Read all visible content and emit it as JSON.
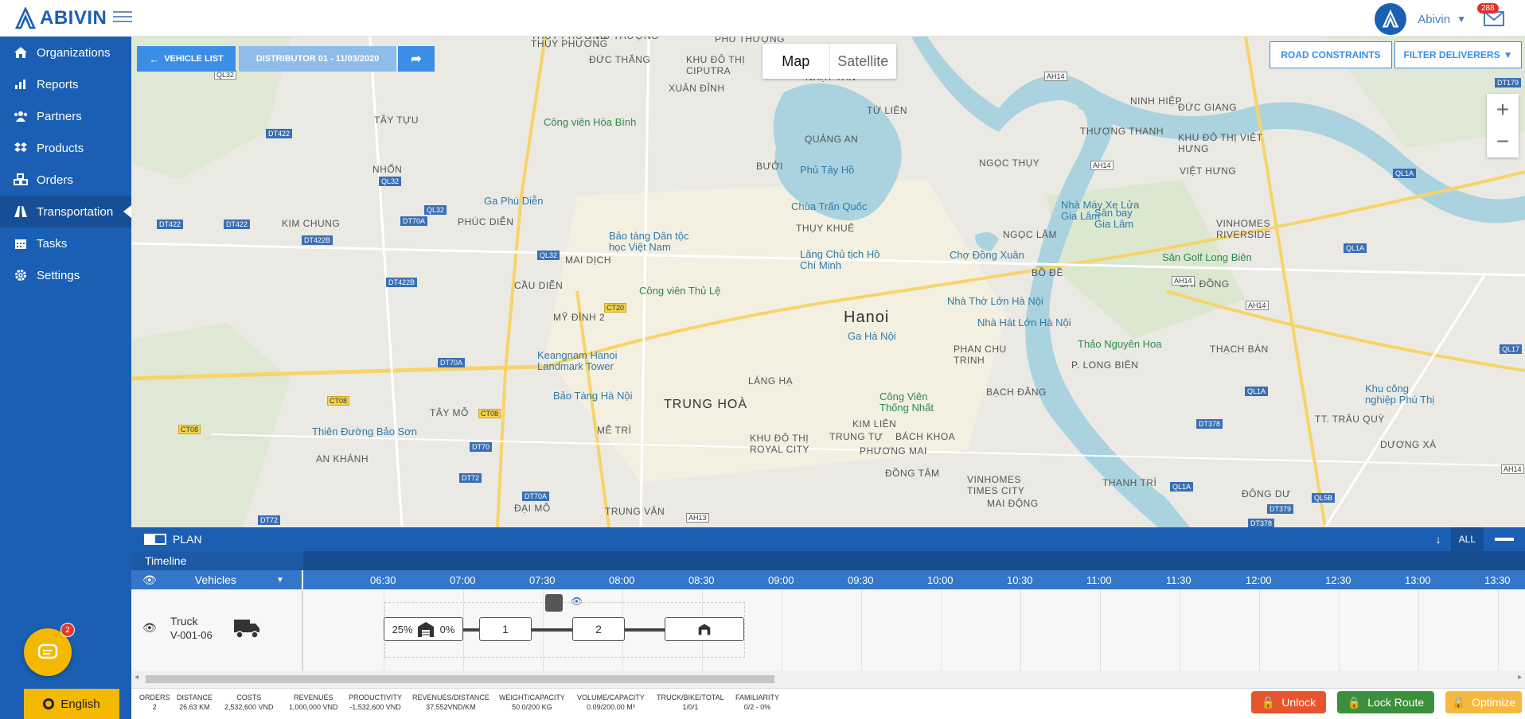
{
  "app": {
    "brand": "ABIVIN"
  },
  "user": {
    "name": "Abivin",
    "mail_count": "288"
  },
  "nav": {
    "items": [
      {
        "label": "Organizations",
        "icon": "home-icon"
      },
      {
        "label": "Reports",
        "icon": "chart-icon"
      },
      {
        "label": "Partners",
        "icon": "users-icon"
      },
      {
        "label": "Products",
        "icon": "dropbox-icon"
      },
      {
        "label": "Orders",
        "icon": "cubes-icon"
      },
      {
        "label": "Transportation",
        "icon": "road-icon",
        "active": true
      },
      {
        "label": "Tasks",
        "icon": "calendar-icon"
      },
      {
        "label": "Settings",
        "icon": "gear-icon"
      }
    ]
  },
  "chat": {
    "badge": "2"
  },
  "language": {
    "label": "English"
  },
  "map": {
    "vehicle_list_btn": "VEHICLE LIST",
    "distributor_btn": "DISTRIBUTOR 01 - 11/03/2020",
    "road_constraints_btn": "ROAD CONSTRAINTS",
    "filter_deliverers_btn": "FILTER DELIVERERS",
    "map_tab": "Map",
    "satellite_tab": "Satellite",
    "zoom_in": "+",
    "zoom_out": "−",
    "labels": {
      "hanoi": "Hanoi",
      "trung_hoa": "TRUNG HOÀ",
      "thuy_phuong": "THỤY PHƯƠNG",
      "duc_thang": "ĐỨC THẮNG",
      "phu_thuong": "PHÚ THƯỢNG",
      "xuan_dinh": "XUÂN ĐỈNH",
      "tay_tuu": "TÂY TỰU",
      "nhon": "NHỔN",
      "kim_chung": "KIM CHUNG",
      "phuc_dien": "PHÚC DIỄN",
      "mai_dich": "MAI DỊCH",
      "cau_dien": "CẦU DIỄN",
      "my_dinh2": "MỸ ĐÌNH 2",
      "tay_mo": "TÂY MỖ",
      "an_khanh": "AN KHÁNH",
      "me_tri": "MỄ TRÌ",
      "dai_mo": "ĐẠI MỖ",
      "trung_van": "TRUNG VĂN",
      "quang_an": "QUẢNG AN",
      "buoi": "BƯỞI",
      "thuy_khue": "THỤY KHUÊ",
      "tu_lien": "TỨ LIÊN",
      "ngoc_thuy": "NGỌC THỤY",
      "ngoc_lam": "NGỌC LÂM",
      "bo_de": "BỒ ĐỀ",
      "sai_dong": "SÀI ĐỒNG",
      "thach_ban": "THẠCH BÀN",
      "p_long_bien": "P. LONG BIÊN",
      "lang_ha": "LÁNG HẠ",
      "kim_lien": "KIM LIÊN",
      "trung_tu": "TRUNG TỰ",
      "bach_khoa": "BÁCH KHOA",
      "phuong_mai": "PHƯƠNG MAI",
      "dong_tam": "ĐỒNG TÂM",
      "mai_dong": "MAI ĐỘNG",
      "thanh_tri": "THANH TRÌ",
      "bach_dang": "BẠCH ĐẰNG",
      "phan_chu_trinh": "PHAN CHU TRINH",
      "thuong_thanh": "THƯỢNG THANH",
      "duc_giang": "ĐỨC GIANG",
      "viet_hung": "VIỆT HƯNG",
      "ninh_hiep": "NINH HIỆP",
      "duong_xa": "DƯƠNG XÁ",
      "tt_trau_quy": "TT. TRÂU QUỲ",
      "dong_du": "ĐÔNG DƯ",
      "cv_hoa_binh": "Công viên Hòa Bình",
      "ga_phu_dien": "Ga Phú Diễn",
      "bao_tang_dan_toc": "Bảo tàng Dân tộc học Việt Nam",
      "cv_thu_le": "Công viên Thủ Lệ",
      "keangnam": "Keangnam Hanoi Landmark Tower",
      "bao_tang_ha_noi": "Bảo Tàng Hà Nội",
      "thien_duong": "Thiên Đường Bảo Sơn",
      "phu_tay_ho": "Phủ Tây Hồ",
      "chua_tran_quoc": "Chùa Trấn Quốc",
      "lang_chu_tich": "Lăng Chủ tịch Hồ Chí Minh",
      "cho_dong_xuan": "Chợ Đồng Xuân",
      "nha_tho": "Nhà Thờ Lớn Hà Nội",
      "nha_hat": "Nhà Hát Lớn Hà Nội",
      "ga_ha_noi": "Ga Hà Nội",
      "cv_thong_nhat": "Công Viên Thống Nhất",
      "thao_nguyen": "Thảo Nguyên Hoa",
      "san_bay": "Sân bay Gia Lâm",
      "nha_may_xe_lua": "Nhà Máy Xe Lửa Gia Lâm",
      "san_golf": "Sân Golf Long Biên",
      "vinhomes_riverside": "VINHOMES RIVERSIDE",
      "vinhomes_times": "VINHOMES TIMES CITY",
      "khu_do_thi_ciputra": "KHU ĐÔ THỊ CIPUTRA",
      "khu_do_thi_royal": "KHU ĐÔ THỊ ROYAL CITY",
      "khu_do_thi_viet_hung": "KHU ĐÔ THỊ VIỆT HƯNG",
      "kcn_phu_thi": "Khu công nghiệp Phú Thị",
      "nhat_tan": "NHẬT TÂN"
    },
    "shields": {
      "ql32a": "QL32",
      "dt422a": "DT422",
      "dt422b": "DT422",
      "dt422c": "DT422",
      "ql32b": "QL32",
      "dt70a": "DT70A",
      "ql32c": "QL32",
      "ql32d": "QL32",
      "dt422b2": "DT422B",
      "dt422b3": "DT422B",
      "ct20": "CT20",
      "dt70a2": "DT70A",
      "ct08a": "CT08",
      "ct08b": "CT08",
      "ct08c": "CT08",
      "dt70": "DT70",
      "dt72a": "DT72",
      "dt70a3": "DT70A",
      "ah13": "AH13",
      "dt72b": "DT72",
      "ah14a": "AH14",
      "ah14b": "AH14",
      "ah14c": "AH14",
      "ah14d": "AH14",
      "ah14e": "AH14",
      "ql1a1": "QL1A",
      "ql1a2": "QL1A",
      "ql1a3": "QL1A",
      "ql1a4": "QL1A",
      "dt179": "DT179",
      "ql17": "QL17",
      "dt378a": "DT378",
      "dt378b": "DT378",
      "dt379": "DT379",
      "ql5b": "QL5B",
      "ah14f": "AH14"
    }
  },
  "plan": {
    "title": "PLAN",
    "all_label": "ALL",
    "timeline_label": "Timeline",
    "vehicles_label": "Vehicles",
    "times": [
      "06:30",
      "07:00",
      "07:30",
      "08:00",
      "08:30",
      "09:00",
      "09:30",
      "10:00",
      "10:30",
      "11:00",
      "11:30",
      "12:00",
      "12:30",
      "13:00",
      "13:30"
    ],
    "vehicle": {
      "type": "Truck",
      "id": "V-001-06"
    },
    "route": {
      "start_pct": "25%",
      "end_pct": "0%",
      "stop1": "1",
      "stop2": "2"
    }
  },
  "stats": [
    {
      "label": "ORDERS",
      "value": "2"
    },
    {
      "label": "DISTANCE",
      "value": "26.63 KM"
    },
    {
      "label": "COSTS",
      "value": "2,532,600 VND"
    },
    {
      "label": "REVENUES",
      "value": "1,000,000 VND"
    },
    {
      "label": "PRODUCTIVITY",
      "value": "-1,532,600 VND"
    },
    {
      "label": "REVENUES/DISTANCE",
      "value": "37,552VND/KM"
    },
    {
      "label": "WEIGHT/CAPACITY",
      "value": "50.0/200 KG"
    },
    {
      "label": "VOLUME/CAPACITY",
      "value": "0.09/200.00 M³"
    },
    {
      "label": "TRUCK/BIKE/TOTAL",
      "value": "1/0/1"
    },
    {
      "label": "FAMILIARITY",
      "value": "0/2 - 0%"
    }
  ],
  "actions": {
    "unlock": "Unlock",
    "lock_route": "Lock Route",
    "optimize": "Optimize"
  },
  "colors": {
    "primary": "#1a5fb4",
    "unlock": "#e8542e",
    "lock": "#3c8f3c",
    "optimize": "#f5b840"
  }
}
